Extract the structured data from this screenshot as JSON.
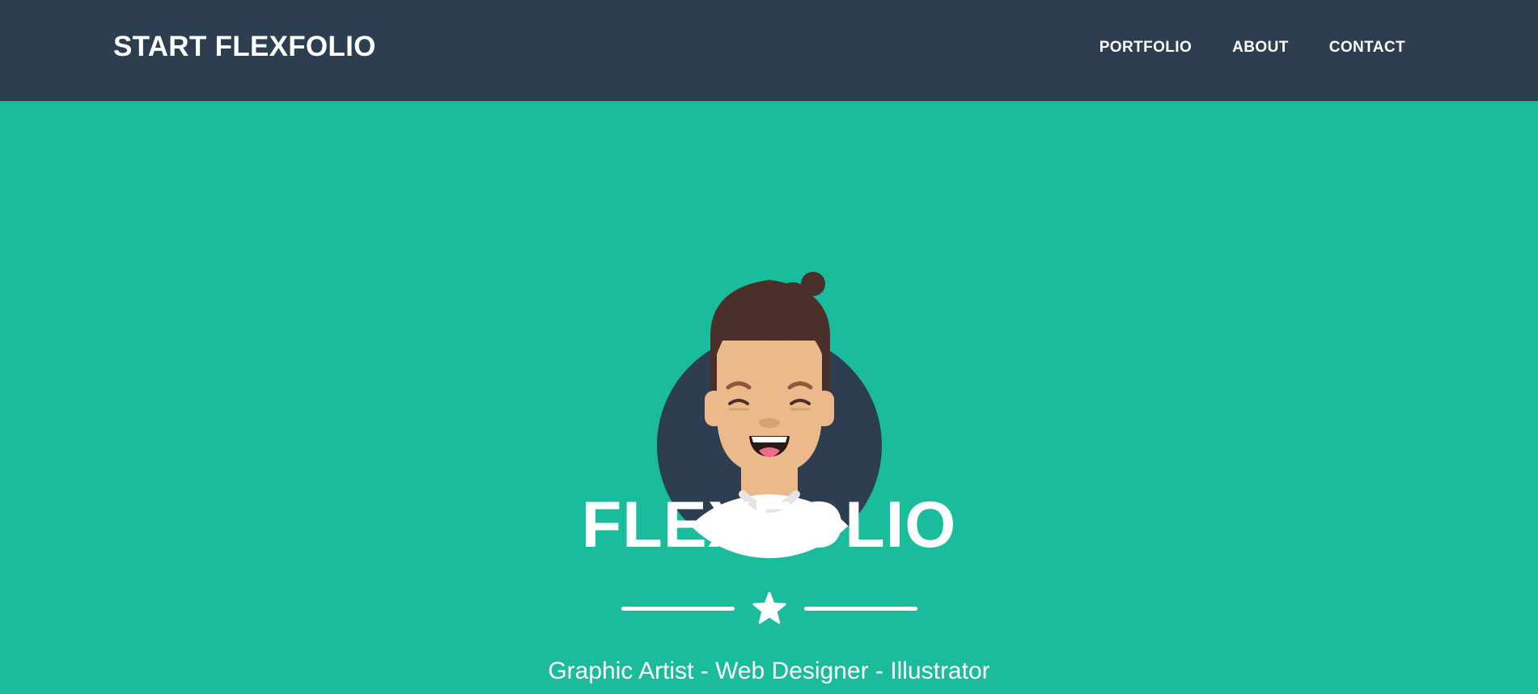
{
  "navbar": {
    "brand": "START FLEXFOLIO",
    "links": [
      "PORTFOLIO",
      "ABOUT",
      "CONTACT"
    ]
  },
  "masthead": {
    "title": "FLEXFOLIO",
    "subtitle": "Graphic Artist - Web Designer - Illustrator",
    "avatar_icon": "avatar-illustration",
    "divider_icon": "star-icon"
  },
  "colors": {
    "navbar_bg": "#2c3e50",
    "masthead_bg": "#1abc9c",
    "text": "#ffffff",
    "avatar_bg": "#2c3e50",
    "hair": "#4b2f2a",
    "skin": "#ebb98a"
  }
}
